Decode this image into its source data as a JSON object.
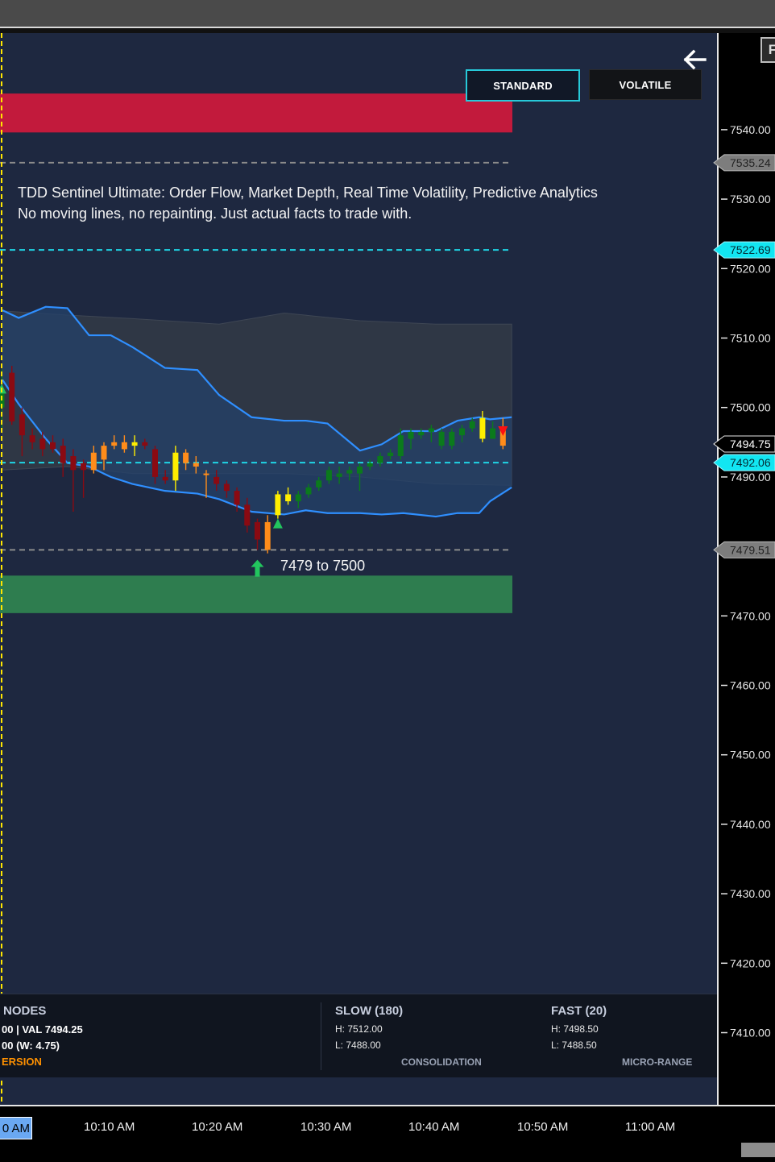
{
  "toolbar": {
    "standard_label": "STANDARD",
    "volatile_label": "VOLATILE",
    "f_label": "F"
  },
  "caption": {
    "line1": "TDD Sentinel Ultimate: Order Flow, Market Depth, Real Time Volatility, Predictive Analytics",
    "line2": "No moving lines, no repainting. Just actual facts to trade with."
  },
  "annotation": {
    "range_text": "7479 to 7500"
  },
  "panel": {
    "nodes": {
      "title": "NODES",
      "line1": "00  |  VAL 7494.25",
      "line2": "00 (W: 4.75)",
      "line3": "ERSION"
    },
    "slow": {
      "title": "SLOW (180)",
      "high": "H: 7512.00",
      "low": "L: 7488.00",
      "status": "CONSOLIDATION"
    },
    "fast": {
      "title": "FAST (20)",
      "high": "H: 7498.50",
      "low": "L: 7488.50",
      "status": "MICRO-RANGE"
    }
  },
  "time_axis": {
    "current": "0 AM",
    "labels": [
      "10:10 AM",
      "10:20 AM",
      "10:30 AM",
      "10:40 AM",
      "10:50 AM",
      "11:00 AM"
    ]
  },
  "chart_data": {
    "type": "candlestick",
    "ylim": [
      7402,
      7549
    ],
    "x_minutes": [
      0,
      59
    ],
    "y_ticks": [
      7410,
      7420,
      7430,
      7440,
      7450,
      7460,
      7470,
      7480,
      7490,
      7500,
      7510,
      7520,
      7530,
      7540
    ],
    "y_tick_labels": [
      "7410.00",
      "7420.00",
      "7430.00",
      "7440.00",
      "7450.00",
      "7460.00",
      "7470.00",
      "7480.00",
      "7490.00",
      "7500.00",
      "7510.00",
      "7520.00",
      "7530.00",
      "7540.00"
    ],
    "x_ticks": [
      10,
      20,
      30,
      40,
      50,
      60
    ],
    "price_tags": [
      {
        "value": 7535.24,
        "label": "7535.24",
        "style": "gray"
      },
      {
        "value": 7522.69,
        "label": "7522.69",
        "style": "cyan"
      },
      {
        "value": 7494.75,
        "label": "7494.75",
        "style": "black"
      },
      {
        "value": 7492.06,
        "label": "7492.06",
        "style": "cyan"
      },
      {
        "value": 7479.51,
        "label": "7479.51",
        "style": "gray"
      }
    ],
    "levels": [
      {
        "value": 7535.24,
        "style": "gray-dashed"
      },
      {
        "value": 7522.69,
        "style": "cyan-dashed"
      },
      {
        "value": 7492.06,
        "style": "cyan-dashed"
      },
      {
        "value": 7479.51,
        "style": "gray-dashed"
      }
    ],
    "zones": [
      {
        "low": 7539.6,
        "high": 7545.2,
        "color": "#c21a3c"
      },
      {
        "low": 7470.4,
        "high": 7475.8,
        "color": "#2e7d4f"
      }
    ],
    "slow_band": {
      "x": [
        0,
        6,
        12,
        20,
        26,
        33,
        40,
        47
      ],
      "upper": [
        7513.9,
        7513.3,
        7512.8,
        7512.0,
        7513.6,
        7512.5,
        7512.0,
        7512.0
      ],
      "lower": [
        7491.0,
        7491.5,
        7490.5,
        7490.5,
        7490.5,
        7490.0,
        7489.0,
        7488.8
      ]
    },
    "fast_band": {
      "x": [
        0,
        1.5,
        4,
        6,
        8,
        10,
        12,
        15,
        18,
        20,
        23,
        26,
        28,
        30,
        33,
        35,
        37,
        40,
        42,
        44,
        45,
        47
      ],
      "upper": [
        7514.0,
        7512.9,
        7514.5,
        7514.3,
        7510.4,
        7510.4,
        7508.7,
        7505.7,
        7505.4,
        7501.8,
        7498.6,
        7498.1,
        7498.1,
        7497.7,
        7493.8,
        7494.7,
        7496.6,
        7496.6,
        7498.1,
        7498.6,
        7498.3,
        7498.6
      ],
      "lower": [
        7504.0,
        7500.5,
        7495.5,
        7492.0,
        7491.5,
        7490.0,
        7489.0,
        7488.0,
        7487.6,
        7486.8,
        7485.0,
        7484.6,
        7485.2,
        7484.8,
        7484.8,
        7484.6,
        7484.8,
        7484.3,
        7484.8,
        7484.8,
        7486.5,
        7488.5
      ]
    },
    "candles": [
      {
        "o": 7500,
        "h": 7505.5,
        "l": 7497,
        "c": 7502.5,
        "color": "green"
      },
      {
        "o": 7505,
        "h": 7506,
        "l": 7497.5,
        "c": 7498,
        "color": "darkred"
      },
      {
        "o": 7499,
        "h": 7500,
        "l": 7493,
        "c": 7496,
        "color": "darkred"
      },
      {
        "o": 7496,
        "h": 7497,
        "l": 7494,
        "c": 7495,
        "color": "darkred"
      },
      {
        "o": 7495.5,
        "h": 7496.5,
        "l": 7493,
        "c": 7494,
        "color": "darkred"
      },
      {
        "o": 7495,
        "h": 7496,
        "l": 7493.5,
        "c": 7494,
        "color": "darkred"
      },
      {
        "o": 7494.5,
        "h": 7495.5,
        "l": 7490,
        "c": 7492,
        "color": "darkred"
      },
      {
        "o": 7493,
        "h": 7494,
        "l": 7485,
        "c": 7491,
        "color": "darkred"
      },
      {
        "o": 7492,
        "h": 7492.5,
        "l": 7487,
        "c": 7491,
        "color": "darkred"
      },
      {
        "o": 7491,
        "h": 7494.5,
        "l": 7490.5,
        "c": 7493.5,
        "color": "orange"
      },
      {
        "o": 7492.5,
        "h": 7495,
        "l": 7491,
        "c": 7494.5,
        "color": "orange"
      },
      {
        "o": 7494.5,
        "h": 7496,
        "l": 7494,
        "c": 7495,
        "color": "orange"
      },
      {
        "o": 7495,
        "h": 7496,
        "l": 7493.5,
        "c": 7494,
        "color": "orange"
      },
      {
        "o": 7494.5,
        "h": 7496,
        "l": 7493,
        "c": 7495,
        "color": "yellow"
      },
      {
        "o": 7495,
        "h": 7495.5,
        "l": 7494,
        "c": 7494.5,
        "color": "darkred"
      },
      {
        "o": 7494,
        "h": 7494.5,
        "l": 7489,
        "c": 7490,
        "color": "darkred"
      },
      {
        "o": 7490,
        "h": 7491,
        "l": 7489,
        "c": 7489.5,
        "color": "darkred"
      },
      {
        "o": 7489.5,
        "h": 7494.5,
        "l": 7488,
        "c": 7493.5,
        "color": "yellow"
      },
      {
        "o": 7493.5,
        "h": 7494,
        "l": 7491,
        "c": 7492,
        "color": "orange"
      },
      {
        "o": 7492,
        "h": 7493,
        "l": 7490.5,
        "c": 7491.5,
        "color": "orange"
      },
      {
        "o": 7490.5,
        "h": 7491,
        "l": 7487,
        "c": 7490.5,
        "color": "orange"
      },
      {
        "o": 7490,
        "h": 7491,
        "l": 7488,
        "c": 7489,
        "color": "darkred"
      },
      {
        "o": 7489,
        "h": 7489.5,
        "l": 7487,
        "c": 7488,
        "color": "darkred"
      },
      {
        "o": 7488,
        "h": 7488.5,
        "l": 7485,
        "c": 7486,
        "color": "darkred"
      },
      {
        "o": 7486,
        "h": 7487,
        "l": 7482,
        "c": 7483,
        "color": "darkred"
      },
      {
        "o": 7483.5,
        "h": 7484,
        "l": 7479.5,
        "c": 7481,
        "color": "darkred"
      },
      {
        "o": 7479.5,
        "h": 7484.5,
        "l": 7479,
        "c": 7483.5,
        "color": "orange"
      },
      {
        "o": 7484.5,
        "h": 7488,
        "l": 7484,
        "c": 7487.5,
        "color": "yellow"
      },
      {
        "o": 7486.5,
        "h": 7488.5,
        "l": 7486,
        "c": 7487.5,
        "color": "yellow"
      },
      {
        "o": 7486.5,
        "h": 7488,
        "l": 7485.5,
        "c": 7487.5,
        "color": "green"
      },
      {
        "o": 7487.5,
        "h": 7489,
        "l": 7487,
        "c": 7488.5,
        "color": "green"
      },
      {
        "o": 7488.5,
        "h": 7490,
        "l": 7488,
        "c": 7489.5,
        "color": "green"
      },
      {
        "o": 7489.5,
        "h": 7491.5,
        "l": 7489,
        "c": 7491,
        "color": "green"
      },
      {
        "o": 7490,
        "h": 7491.5,
        "l": 7489,
        "c": 7490.5,
        "color": "green"
      },
      {
        "o": 7490.5,
        "h": 7491.5,
        "l": 7489.5,
        "c": 7491,
        "color": "green"
      },
      {
        "o": 7490.5,
        "h": 7492,
        "l": 7488,
        "c": 7491.5,
        "color": "green"
      },
      {
        "o": 7491.5,
        "h": 7492.5,
        "l": 7491,
        "c": 7492,
        "color": "green"
      },
      {
        "o": 7492,
        "h": 7493.5,
        "l": 7491.5,
        "c": 7493,
        "color": "green"
      },
      {
        "o": 7493,
        "h": 7494,
        "l": 7492.5,
        "c": 7493.5,
        "color": "green"
      },
      {
        "o": 7493,
        "h": 7497,
        "l": 7492.5,
        "c": 7496,
        "color": "green"
      },
      {
        "o": 7495.5,
        "h": 7497,
        "l": 7494,
        "c": 7496.5,
        "color": "green"
      },
      {
        "o": 7496,
        "h": 7497,
        "l": 7495.5,
        "c": 7496.5,
        "color": "green"
      },
      {
        "o": 7496.5,
        "h": 7497.5,
        "l": 7495,
        "c": 7497,
        "color": "green"
      },
      {
        "o": 7494.5,
        "h": 7497,
        "l": 7494,
        "c": 7496.5,
        "color": "green"
      },
      {
        "o": 7494.5,
        "h": 7497,
        "l": 7494,
        "c": 7496.5,
        "color": "green"
      },
      {
        "o": 7496,
        "h": 7497.5,
        "l": 7495,
        "c": 7497,
        "color": "green"
      },
      {
        "o": 7497,
        "h": 7498.5,
        "l": 7496.5,
        "c": 7498,
        "color": "green"
      },
      {
        "o": 7495.5,
        "h": 7499.5,
        "l": 7495,
        "c": 7498.5,
        "color": "yellow"
      },
      {
        "o": 7497,
        "h": 7498,
        "l": 7495.5,
        "c": 7495.5,
        "color": "green"
      },
      {
        "o": 7497,
        "h": 7498.5,
        "l": 7494,
        "c": 7494.5,
        "color": "orange"
      }
    ],
    "signals": [
      {
        "type": "buy",
        "candle": 27,
        "value": 7483.3,
        "color": "#22c55e"
      },
      {
        "type": "buy-arrow",
        "candle": 25,
        "value": 7476.8,
        "color": "#22c55e"
      },
      {
        "type": "sell",
        "candle": 49,
        "value": 7496.6,
        "color": "#ff1010"
      },
      {
        "type": "buy",
        "candle": 0,
        "value": 7502.7,
        "color": "#22c55e"
      }
    ]
  }
}
